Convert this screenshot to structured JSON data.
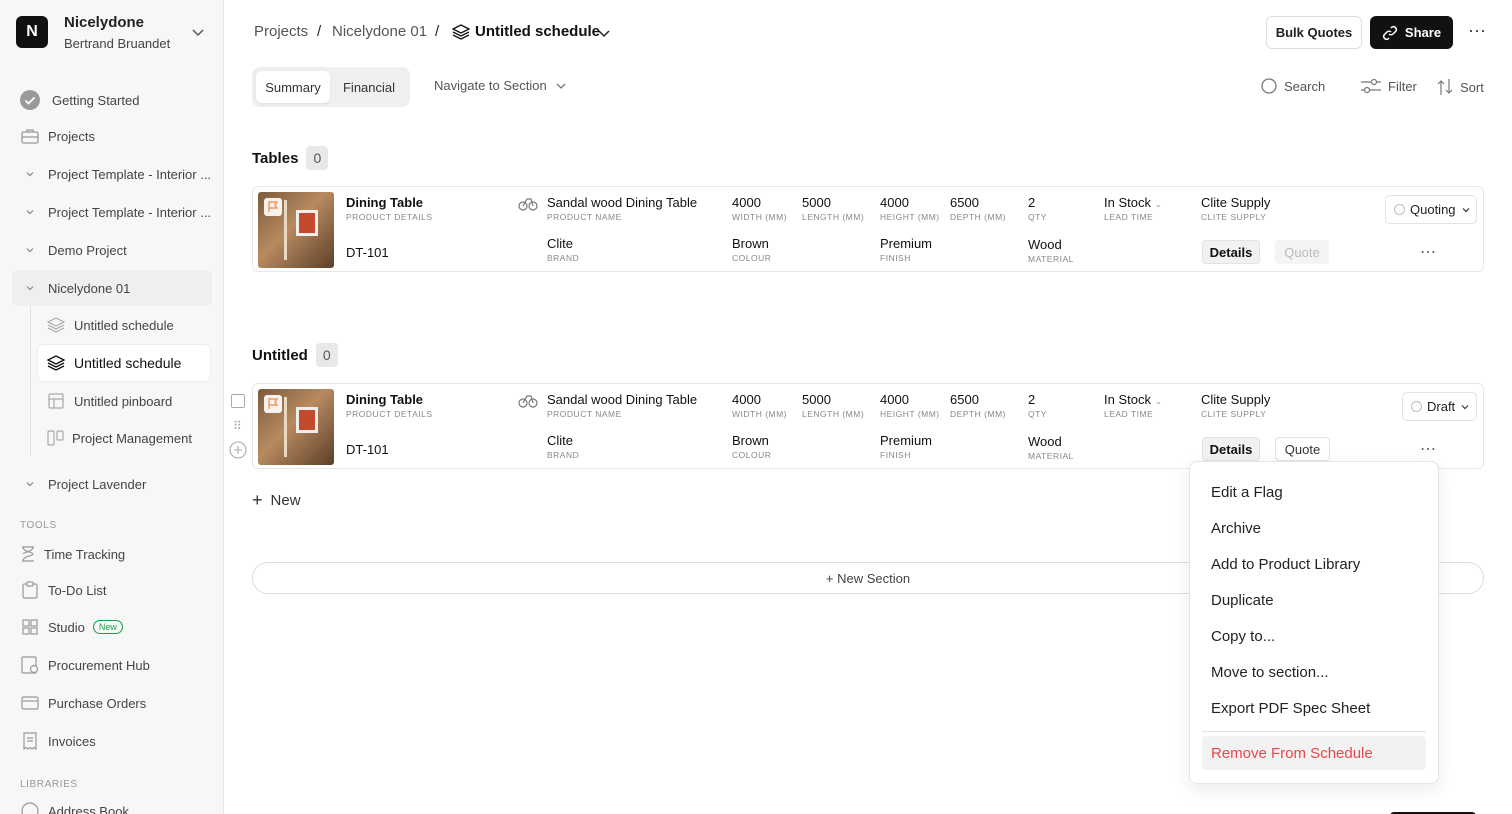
{
  "workspace": {
    "logo_letter": "N",
    "name": "Nicelydone",
    "user": "Bertrand Bruandet"
  },
  "sidebar": {
    "getting_started": "Getting Started",
    "projects": "Projects",
    "tree": [
      "Project Template - Interior ...",
      "Project Template - Interior ...",
      "Demo Project",
      "Nicelydone 01"
    ],
    "children": [
      "Untitled schedule",
      "Untitled schedule",
      "Untitled pinboard",
      "Project Management"
    ],
    "project_lavender": "Project Lavender",
    "tools_label": "TOOLS",
    "tools": [
      "Time Tracking",
      "To-Do List",
      "Studio",
      "Procurement Hub",
      "Purchase Orders",
      "Invoices"
    ],
    "studio_badge": "New",
    "libraries_label": "LIBRARIES",
    "address_book": "Address Book"
  },
  "header": {
    "crumbs": [
      "Projects",
      "Nicelydone 01",
      "Untitled schedule"
    ],
    "separator": "/",
    "bulk_quotes": "Bulk Quotes",
    "share": "Share"
  },
  "toolbar": {
    "tabs": [
      "Summary",
      "Financial"
    ],
    "navigate": "Navigate to Section",
    "search": "Search",
    "filter": "Filter",
    "sort": "Sort"
  },
  "sections": [
    {
      "title": "Tables",
      "count": "0",
      "item": {
        "name": "Dining Table",
        "name_label": "PRODUCT DETAILS",
        "code": "DT-101",
        "product_name": "Sandal wood Dining Table",
        "product_name_label": "PRODUCT NAME",
        "brand": "Clite",
        "brand_label": "BRAND",
        "width": "4000",
        "width_label": "WIDTH (MM)",
        "length": "5000",
        "length_label": "LENGTH (MM)",
        "height": "4000",
        "height_label": "HEIGHT (MM)",
        "depth": "6500",
        "depth_label": "DEPTH (MM)",
        "colour": "Brown",
        "colour_label": "COLOUR",
        "finish": "Premium",
        "finish_label": "FINISH",
        "qty": "2",
        "qty_label": "QTY",
        "material": "Wood",
        "material_label": "MATERIAL",
        "lead": "In Stock",
        "lead_label": "LEAD TIME",
        "supplier": "Clite Supply",
        "supplier_label": "CLITE SUPPLY",
        "status": "Quoting",
        "details": "Details",
        "quote": "Quote"
      }
    },
    {
      "title": "Untitled",
      "count": "0",
      "item": {
        "name": "Dining Table",
        "name_label": "PRODUCT DETAILS",
        "code": "DT-101",
        "product_name": "Sandal wood Dining Table",
        "product_name_label": "PRODUCT NAME",
        "brand": "Clite",
        "brand_label": "BRAND",
        "width": "4000",
        "width_label": "WIDTH (MM)",
        "length": "5000",
        "length_label": "LENGTH (MM)",
        "height": "4000",
        "height_label": "HEIGHT (MM)",
        "depth": "6500",
        "depth_label": "DEPTH (MM)",
        "colour": "Brown",
        "colour_label": "COLOUR",
        "finish": "Premium",
        "finish_label": "FINISH",
        "qty": "2",
        "qty_label": "QTY",
        "material": "Wood",
        "material_label": "MATERIAL",
        "lead": "In Stock",
        "lead_label": "LEAD TIME",
        "supplier": "Clite Supply",
        "supplier_label": "CLITE SUPPLY",
        "status": "Draft",
        "details": "Details",
        "quote": "Quote"
      }
    }
  ],
  "new_item": "New",
  "new_section": "+ New Section",
  "context_menu": {
    "items": [
      "Edit a Flag",
      "Archive",
      "Add to Product Library",
      "Duplicate",
      "Copy to...",
      "Move to section...",
      "Export PDF Spec Sheet"
    ],
    "danger": "Remove From Schedule"
  },
  "colors": {
    "accent": "#111111",
    "danger": "#e5484d",
    "new_badge": "#1a9e4b",
    "flag": "#f08a3c"
  }
}
